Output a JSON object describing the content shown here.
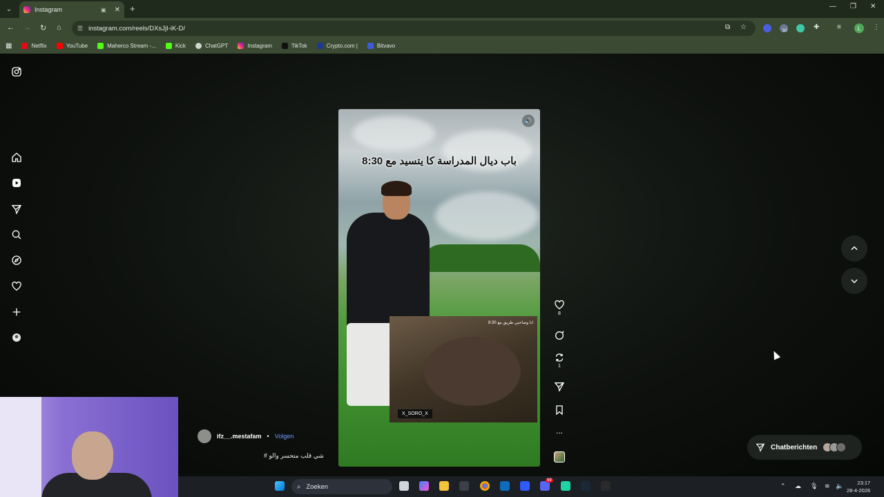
{
  "browser": {
    "tab_title": "Instagram",
    "new_tab_label": "+",
    "url": "instagram.com/reels/DXsJjI-iK-D/",
    "bookmarks": [
      "Netflix",
      "YouTube",
      "Maherco Stream -...",
      "Kick",
      "ChatGPT",
      "Instagram",
      "TikTok",
      "Crypto.com |",
      "Bitvavo"
    ],
    "extension_badge": "50",
    "profile_initial": "L",
    "colors": {
      "chrome": "#3a4a33",
      "tabbar": "#1f2a1c"
    }
  },
  "reel": {
    "overlay_text": "باب ديال المدراسة كا يتسيد مع 8:30",
    "inset_tag": "X_SORO_X",
    "inset_small_text": "انا وصاحبي طريق مع 8:30",
    "author": "ifz__.mestafam",
    "separator": "•",
    "follow_label": "Volgen",
    "description": "شي قلب متحسر والو #",
    "likes": "8",
    "reposts": "1",
    "more_label": "..."
  },
  "chat": {
    "label": "Chatberichten"
  },
  "taskbar": {
    "search_placeholder": "Zoeken",
    "time": "23:17",
    "date": "28-4-2026",
    "mail_badge": "99"
  }
}
